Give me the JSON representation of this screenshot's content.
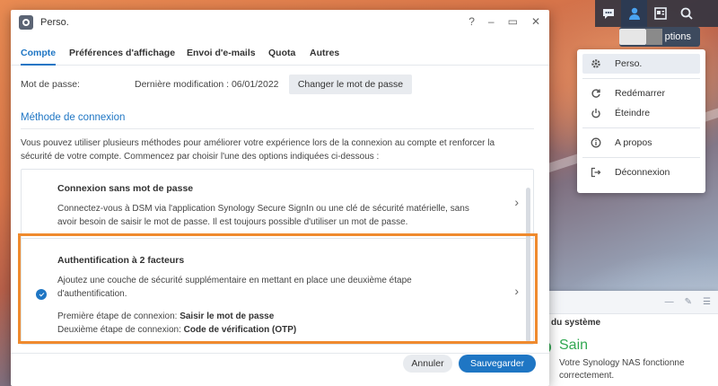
{
  "window": {
    "title": "Perso."
  },
  "window_buttons": [
    "?",
    "–",
    "▭",
    "✕"
  ],
  "tabs": [
    {
      "label": "Compte",
      "active": true
    },
    {
      "label": "Préférences d'affichage",
      "active": false
    },
    {
      "label": "Envoi d'e-mails",
      "active": false
    },
    {
      "label": "Quota",
      "active": false
    },
    {
      "label": "Autres",
      "active": false
    }
  ],
  "password": {
    "label": "Mot de passe:",
    "last_modified": "Dernière modification : 06/01/2022",
    "change_button": "Changer le mot de passe"
  },
  "login_method": {
    "heading": "Méthode de connexion",
    "intro": "Vous pouvez utiliser plusieurs méthodes pour améliorer votre expérience lors de la connexion au compte et renforcer la sécurité de votre compte. Commencez par choisir l'une des options indiquées ci-dessous :",
    "options": [
      {
        "title": "Connexion sans mot de passe",
        "description": "Connectez-vous à DSM via l'application Synology Secure SignIn ou une clé de sécurité matérielle, sans avoir besoin de saisir le mot de passe. Il est toujours possible d'utiliser un mot de passe.",
        "selected": false
      },
      {
        "title": "Authentification à 2 facteurs",
        "description": "Ajoutez une couche de sécurité supplémentaire en mettant en place une deuxième étape d'authentification.",
        "step1_label": "Première étape de connexion:",
        "step1_value": "Saisir le mot de passe",
        "step2_label": "Deuxième étape de connexion:",
        "step2_value": "Code de vérification (OTP)",
        "selected": true
      }
    ]
  },
  "footer": {
    "cancel": "Annuler",
    "save": "Sauvegarder"
  },
  "taskbar": {
    "icons": [
      "chat-icon",
      "user-icon",
      "widgets-icon",
      "search-icon"
    ],
    "tooltip": "ptions"
  },
  "menu": {
    "items": [
      {
        "label": "Perso.",
        "icon": "gear-icon",
        "active": true
      },
      {
        "label": "Redémarrer",
        "icon": "restart-icon",
        "active": false
      },
      {
        "label": "Éteindre",
        "icon": "power-icon",
        "active": false
      },
      {
        "label": "A propos",
        "icon": "info-icon",
        "active": false
      },
      {
        "label": "Déconnexion",
        "icon": "logout-icon",
        "active": false
      }
    ]
  },
  "widget": {
    "title": "du système",
    "status": "Sain",
    "description": "Votre Synology NAS fonctionne correctement."
  },
  "colors": {
    "accent": "#1f76c4",
    "highlight": "#ef8a2e",
    "healthy": "#32a852"
  }
}
